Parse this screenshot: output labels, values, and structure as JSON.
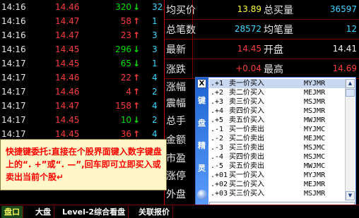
{
  "ticks": [
    {
      "time": "14:16",
      "price": "14.46",
      "vol": "320",
      "dir": "down",
      "extra": "32"
    },
    {
      "time": "14:16",
      "price": "14.47",
      "vol": "58",
      "dir": "up",
      "extra": "1"
    },
    {
      "time": "14:16",
      "price": "14.47",
      "vol": "23",
      "dir": "up",
      "extra": "3"
    },
    {
      "time": "14:16",
      "price": "14.45",
      "vol": "296",
      "dir": "down",
      "extra": "3"
    },
    {
      "time": "14:17",
      "price": "14.45",
      "vol": "65",
      "dir": "down",
      "extra": "1"
    },
    {
      "time": "14:17",
      "price": "14.46",
      "vol": "22",
      "dir": "up",
      "extra": "4"
    },
    {
      "time": "14:17",
      "price": "14.46",
      "vol": "4",
      "dir": "up",
      "extra": "2"
    },
    {
      "time": "14:17",
      "price": "14.47",
      "vol": "158",
      "dir": "up",
      "extra": "4"
    },
    {
      "time": "14:17",
      "price": "14.45",
      "vol": "10",
      "dir": "down",
      "extra": "2"
    },
    {
      "time": "14:17",
      "price": "14.45",
      "vol": "36",
      "dir": "up",
      "extra": "4"
    }
  ],
  "arrows": {
    "up": "↑",
    "down": "↓"
  },
  "quote": {
    "avg_buy_label": "均买价",
    "avg_buy_value": "13.89",
    "total_buy_label": "总买量",
    "total_buy_value": "36597",
    "total_trades_label": "总笔数",
    "total_trades_value": "28572",
    "avg_per_trade_label": "均笔量",
    "avg_per_trade_value": "12",
    "last_label": "最新",
    "last_value": "14.45",
    "open_label": "开盘",
    "open_value": "14.41",
    "change_label": "涨跌",
    "change_value": "+0.04",
    "high_label": "最高",
    "high_value": "14.69",
    "stubs": [
      "涨幅",
      "震幅",
      "总手",
      "金额",
      "市盈",
      "涨停",
      "外盘"
    ]
  },
  "hint": {
    "text": "快捷键委托:直接在个股界面键入数字键盘上的“. +”或“. —”,回车即可立即买入或卖出当前个股↵"
  },
  "keyboard_wizard": {
    "close": "X",
    "title_chars": [
      "键",
      "盘",
      "精",
      "灵"
    ],
    "input_value": ".",
    "scroll_up": "▲",
    "scroll_down": "▼",
    "items": [
      {
        "code": ".+1",
        "desc": "卖一价买入",
        "key": "MYJMR"
      },
      {
        "code": ".+2",
        "desc": "卖二价买入",
        "key": "MEJMR"
      },
      {
        "code": ".+3",
        "desc": "卖三价买入",
        "key": "MSJMR"
      },
      {
        "code": ".+4",
        "desc": "卖四价买入",
        "key": "MSJMR"
      },
      {
        "code": ".+5",
        "desc": "卖五价买入",
        "key": "MWJMR"
      },
      {
        "code": ".-1",
        "desc": "买一价卖出",
        "key": "MYJMC"
      },
      {
        "code": ".-2",
        "desc": "买二价卖出",
        "key": "MEJMC"
      },
      {
        "code": ".-3",
        "desc": "买三价卖出",
        "key": "MSJMC"
      },
      {
        "code": ".-4",
        "desc": "买四价卖出",
        "key": "MSJMC"
      },
      {
        "code": ".-5",
        "desc": "买五价卖出",
        "key": "MWJMC"
      },
      {
        "code": ".+01",
        "desc": "买一价买入",
        "key": "MYJMR"
      },
      {
        "code": ".+02",
        "desc": "买二价买入",
        "key": "MEJMR"
      },
      {
        "code": ".+03",
        "desc": "买三价买入",
        "key": "MSJMR"
      }
    ]
  },
  "tabs": [
    "盘口",
    "大盘",
    "Level-2综合看盘",
    "关联报价"
  ]
}
